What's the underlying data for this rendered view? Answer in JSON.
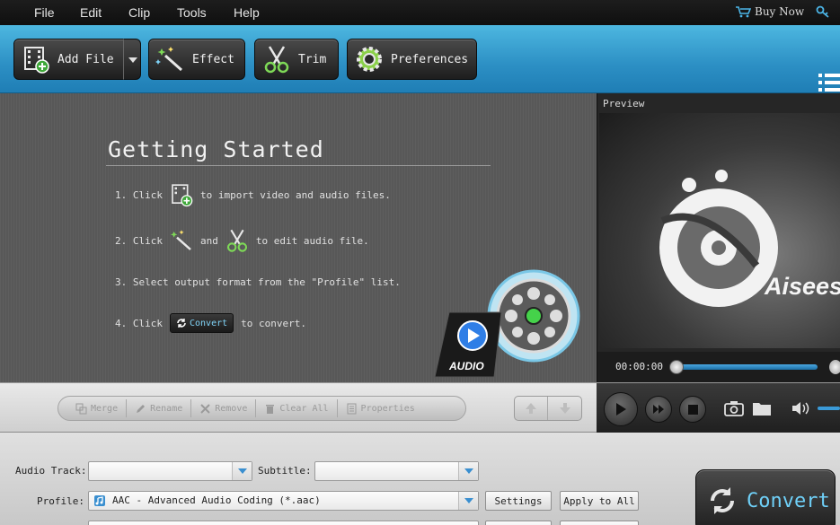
{
  "menu": {
    "items": [
      "File",
      "Edit",
      "Clip",
      "Tools",
      "Help"
    ],
    "buy_now": "Buy Now"
  },
  "toolbar": {
    "add_file": "Add File",
    "effect": "Effect",
    "trim": "Trim",
    "preferences": "Preferences"
  },
  "getting_started": {
    "title": "Getting Started",
    "step1_prefix": "1. Click",
    "step1_suffix": "to import video and audio files.",
    "step2_prefix": "2. Click",
    "step2_and": "and",
    "step2_suffix": "to edit audio file.",
    "step3": "3. Select output format from the \"Profile\" list.",
    "step4_prefix": "4. Click",
    "step4_button": "Convert",
    "step4_suffix": "to convert.",
    "audio_badge": "AUDIO"
  },
  "preview": {
    "label": "Preview",
    "brand": "Aiseesoft",
    "time": "00:00:00"
  },
  "file_actions": {
    "merge": "Merge",
    "rename": "Rename",
    "remove": "Remove",
    "clear_all": "Clear All",
    "properties": "Properties"
  },
  "settings": {
    "audio_track_label": "Audio Track:",
    "audio_track_value": "",
    "subtitle_label": "Subtitle:",
    "subtitle_value": "",
    "profile_label": "Profile:",
    "profile_value": "AAC - Advanced Audio Coding (*.aac)",
    "settings_button": "Settings",
    "apply_all_button": "Apply to All",
    "convert_button": "Convert"
  },
  "colors": {
    "toolbar_blue": "#2c8fc4",
    "convert_text": "#6fd0f8",
    "seek_blue": "#3a8fd0"
  }
}
